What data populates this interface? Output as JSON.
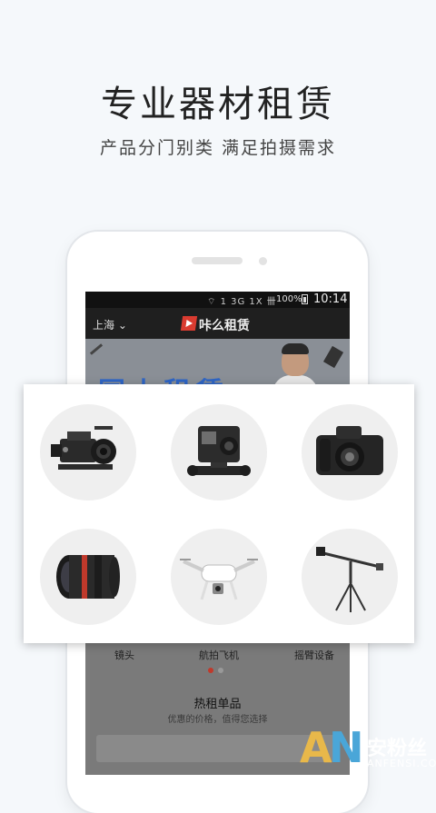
{
  "headline": "专业器材租赁",
  "subline": "产品分门别类 满足拍摄需求",
  "status_bar": {
    "icons": "⌔ 1 3G 1X 卌",
    "battery": "100%",
    "time": "10:14"
  },
  "app_bar": {
    "city": "上海",
    "city_arrow": "⌄",
    "title": "咔么租赁"
  },
  "banner": {
    "text": "国上租赁"
  },
  "categories": {
    "labels": [
      "镜头",
      "航拍飞机",
      "摇臂设备"
    ],
    "items": [
      {
        "name": "cinema-camera"
      },
      {
        "name": "action-camera"
      },
      {
        "name": "dslr-camera"
      },
      {
        "name": "lens"
      },
      {
        "name": "drone"
      },
      {
        "name": "camera-jib"
      }
    ]
  },
  "pager": {
    "active": 0,
    "count": 2,
    "active_color": "#c0392b",
    "inactive_color": "#999999"
  },
  "hot": {
    "title": "热租单品",
    "subtitle": "优惠的价格，值得您选择"
  },
  "watermark": {
    "letter_a": "A",
    "letter_n": "N",
    "chinese": "安粉丝",
    "url": "ANFENSI.COM"
  },
  "colors": {
    "background": "#f5f8fb",
    "watermark_gold": "#e8b84a",
    "watermark_blue": "#4aa6d8",
    "logo_red": "#d93b30"
  }
}
